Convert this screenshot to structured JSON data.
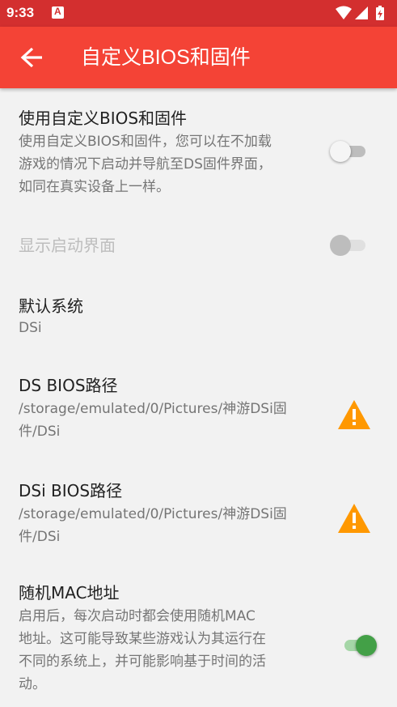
{
  "status_bar": {
    "time": "9:33",
    "icons": [
      "notification-icon",
      "wifi-icon",
      "signal-icon",
      "battery-icon"
    ]
  },
  "app_bar": {
    "title": "自定义BIOS和固件",
    "back_icon": "arrow-back-icon"
  },
  "colors": {
    "status_bar": "#d32f2f",
    "app_bar": "#f44336",
    "switch_on": "#43a047",
    "warning": "#ff9800"
  },
  "settings": [
    {
      "title": "使用自定义BIOS和固件",
      "summary_lines": [
        "使用自定义BIOS和固件，您可以在不加载",
        "游戏的情况下启动并导航至DS固件界面，",
        "如同在真实设备上一样。"
      ],
      "control": "switch",
      "checked": false,
      "enabled": true
    },
    {
      "title": "显示启动界面",
      "control": "switch",
      "checked": false,
      "enabled": false
    },
    {
      "title": "默认系统",
      "summary": "DSi"
    },
    {
      "title": "DS BIOS路径",
      "summary_lines": [
        "/storage/emulated/0/Pictures/神游DSi固",
        "件/DSi"
      ],
      "control": "warning-icon"
    },
    {
      "title": "DSi BIOS路径",
      "summary_lines": [
        "/storage/emulated/0/Pictures/神游DSi固",
        "件/DSi"
      ],
      "control": "warning-icon"
    },
    {
      "title": "随机MAC地址",
      "summary_lines": [
        "启用后，每次启动时都会使用随机MAC",
        "地址。这可能导致某些游戏认为其运行在",
        "不同的系统上，并可能影响基于时间的活",
        "动。"
      ],
      "control": "switch",
      "checked": true,
      "enabled": true
    }
  ]
}
